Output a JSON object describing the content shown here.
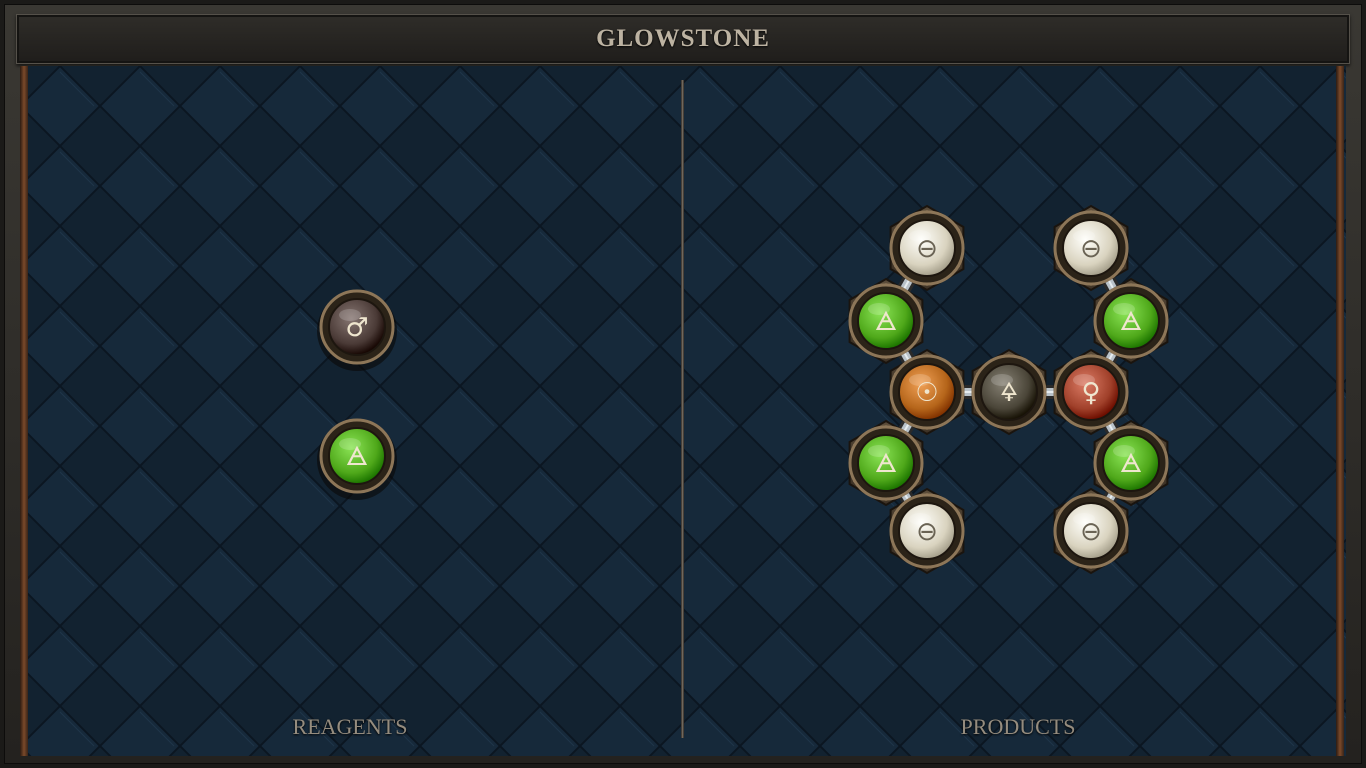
{
  "title": "GLOWSTONE",
  "reagents_label": "REAGENTS",
  "products_label": "PRODUCTS",
  "reagents": [
    {
      "element": "iron",
      "glyph": "♂",
      "color": "#4a3a36"
    },
    {
      "element": "air",
      "glyph": "🜁",
      "color": "#4fa81a"
    }
  ],
  "product_atoms": [
    {
      "element": "salt",
      "glyph": "⊖",
      "color": "#d9d3bf"
    },
    {
      "element": "air",
      "glyph": "🜁",
      "color": "#4fa81a"
    },
    {
      "element": "gold",
      "glyph": "☉",
      "color": "#b5651a"
    },
    {
      "element": "air",
      "glyph": "🜁",
      "color": "#4fa81a"
    },
    {
      "element": "salt",
      "glyph": "⊖",
      "color": "#d9d3bf"
    },
    {
      "element": "sulfur",
      "glyph": "🜍",
      "color": "#4a4538"
    },
    {
      "element": "salt",
      "glyph": "⊖",
      "color": "#d9d3bf"
    },
    {
      "element": "air",
      "glyph": "🜁",
      "color": "#4fa81a"
    },
    {
      "element": "copper",
      "glyph": "♀",
      "color": "#a0402a"
    },
    {
      "element": "air",
      "glyph": "🜁",
      "color": "#4fa81a"
    },
    {
      "element": "salt",
      "glyph": "⊖",
      "color": "#d9d3bf"
    }
  ],
  "product_bonds": [
    [
      0,
      1
    ],
    [
      1,
      2
    ],
    [
      2,
      3
    ],
    [
      3,
      4
    ],
    [
      2,
      5
    ],
    [
      5,
      8
    ],
    [
      6,
      7
    ],
    [
      7,
      8
    ],
    [
      8,
      9
    ],
    [
      9,
      10
    ]
  ]
}
